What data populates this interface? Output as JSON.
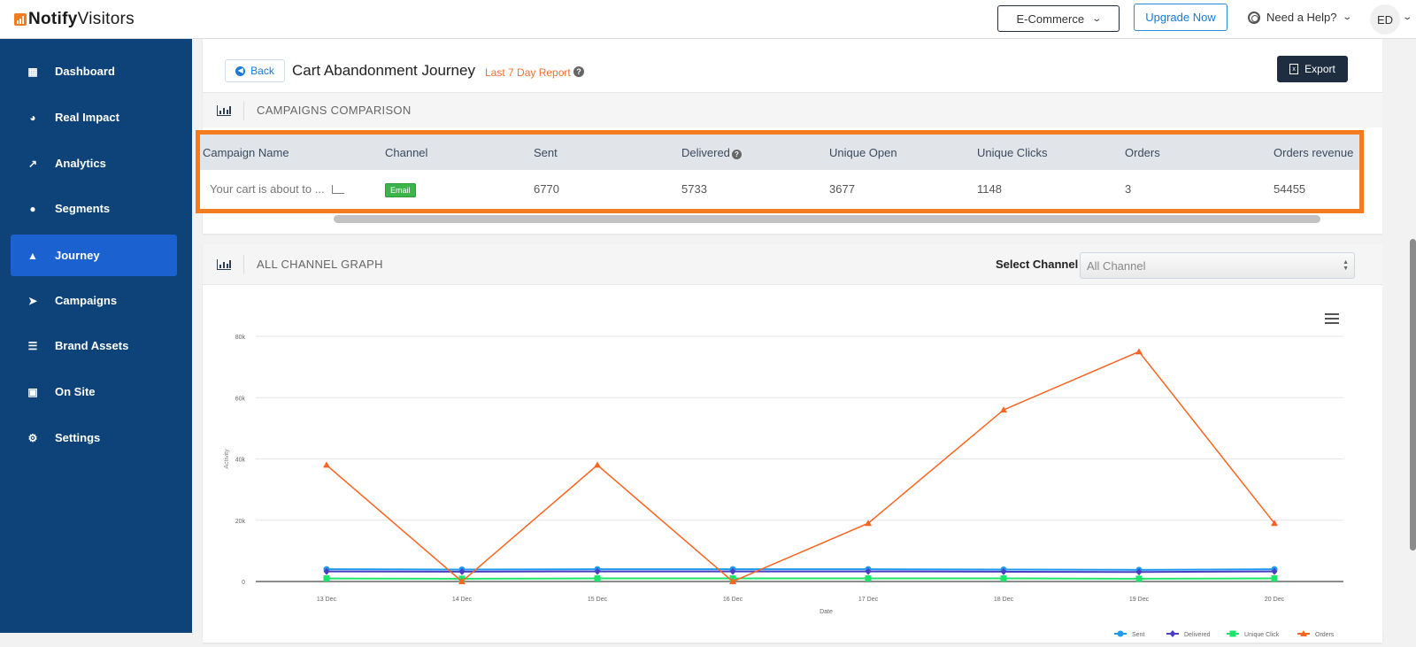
{
  "app": {
    "logo_bold": "Notify",
    "logo_regular": "Visitors"
  },
  "topbar": {
    "workspace": "E-Commerce",
    "upgrade": "Upgrade Now",
    "help": "Need a Help?",
    "avatar_initials": "ED"
  },
  "sidebar": {
    "items": [
      {
        "label": "Dashboard",
        "icon": "grid-icon",
        "active": false
      },
      {
        "label": "Real Impact",
        "icon": "gauge-icon",
        "active": false
      },
      {
        "label": "Analytics",
        "icon": "line-chart-icon",
        "active": false
      },
      {
        "label": "Segments",
        "icon": "users-icon",
        "active": false
      },
      {
        "label": "Journey",
        "icon": "sitemap-icon",
        "active": true
      },
      {
        "label": "Campaigns",
        "icon": "paper-plane-icon",
        "active": false
      },
      {
        "label": "Brand Assets",
        "icon": "list-card-icon",
        "active": false
      },
      {
        "label": "On Site",
        "icon": "image-file-icon",
        "active": false
      },
      {
        "label": "Settings",
        "icon": "gear-icon",
        "active": false
      }
    ]
  },
  "header": {
    "back": "Back",
    "title": "Cart Abandonment Journey",
    "report_range": "Last 7 Day Report",
    "export": "Export"
  },
  "comparison": {
    "section_title": "CAMPAIGNS COMPARISON",
    "columns": [
      "Campaign Name",
      "Channel",
      "Sent",
      "Delivered",
      "Unique Open",
      "Unique Clicks",
      "Orders",
      "Orders revenue"
    ],
    "rows": [
      {
        "campaign_name": "Your cart is about to ...",
        "channel": "Email",
        "sent": "6770",
        "delivered": "5733",
        "unique_open": "3677",
        "unique_clicks": "1148",
        "orders": "3",
        "orders_revenue": "54455"
      }
    ]
  },
  "graph": {
    "section_title": "ALL CHANNEL GRAPH",
    "select_label": "Select Channel",
    "select_value": "All Channel"
  },
  "chart_data": {
    "type": "line",
    "title": "",
    "xlabel": "Date",
    "ylabel": "Activity",
    "x": [
      "13 Dec",
      "14 Dec",
      "15 Dec",
      "16 Dec",
      "17 Dec",
      "18 Dec",
      "19 Dec",
      "20 Dec"
    ],
    "ylim": [
      0,
      80000
    ],
    "yticks": [
      0,
      20000,
      40000,
      60000,
      80000
    ],
    "ytick_labels": [
      "0",
      "20k",
      "40k",
      "60k",
      "80k"
    ],
    "grid": true,
    "legend_position": "bottom-right",
    "series": [
      {
        "name": "Sent",
        "color": "#1e9af0",
        "marker": "circle",
        "values": [
          4000,
          3900,
          4000,
          4000,
          4000,
          3900,
          3800,
          4000
        ]
      },
      {
        "name": "Delivered",
        "color": "#4a3fc4",
        "marker": "diamond",
        "values": [
          3300,
          3200,
          3300,
          3300,
          3300,
          3200,
          3100,
          3300
        ]
      },
      {
        "name": "Unique Click",
        "color": "#1de46a",
        "marker": "square",
        "values": [
          1000,
          900,
          1000,
          1000,
          1000,
          1000,
          900,
          1000
        ]
      },
      {
        "name": "Orders",
        "color": "#f86522",
        "marker": "triangle",
        "values": [
          38000,
          0,
          38000,
          0,
          19000,
          56000,
          75000,
          19000
        ]
      }
    ]
  }
}
